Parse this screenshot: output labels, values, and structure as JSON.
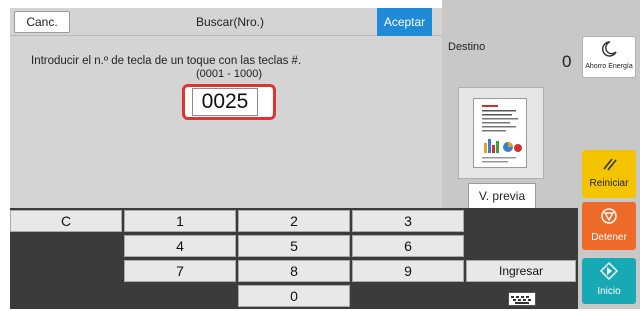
{
  "dialog": {
    "cancel_label": "Canc.",
    "title": "Buscar(Nro.)",
    "accept_label": "Aceptar",
    "instruction": "Introducir el n.º de tecla de un toque con las teclas #.",
    "range": "(0001 - 1000)",
    "value": "0025"
  },
  "destination": {
    "label": "Destino",
    "count": "0",
    "preview_label": "V. previa"
  },
  "side": {
    "energy_label": "Ahorro Energía",
    "reset_label": "Reiniciar",
    "stop_label": "Detener",
    "start_label": "Inicio"
  },
  "keypad": {
    "clear": "C",
    "k1": "1",
    "k2": "2",
    "k3": "3",
    "k4": "4",
    "k5": "5",
    "k6": "6",
    "k7": "7",
    "k8": "8",
    "k9": "9",
    "k0": "0",
    "enter_label": "Ingresar"
  },
  "colors": {
    "accent": "#1f8ad6",
    "highlight": "#e13232",
    "reset": "#f5c400",
    "stop": "#ee6a28",
    "start": "#17a9b4"
  }
}
